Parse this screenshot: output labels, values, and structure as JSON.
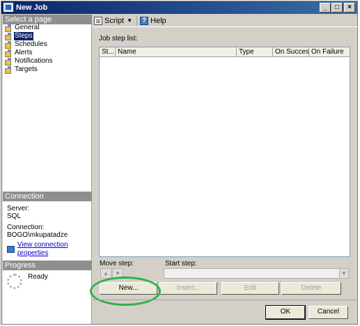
{
  "window": {
    "title": "New Job"
  },
  "left": {
    "select_page_header": "Select a page",
    "pages": [
      {
        "label": "General",
        "selected": false
      },
      {
        "label": "Steps",
        "selected": true
      },
      {
        "label": "Schedules",
        "selected": false
      },
      {
        "label": "Alerts",
        "selected": false
      },
      {
        "label": "Notifications",
        "selected": false
      },
      {
        "label": "Targets",
        "selected": false
      }
    ],
    "connection_header": "Connection",
    "server_label": "Server:",
    "server_value": "SQL",
    "connection_label": "Connection:",
    "connection_value": "BOGO\\mkupatadze",
    "view_connection_link": "View connection properties",
    "progress_header": "Progress",
    "progress_status": "Ready"
  },
  "toolbar": {
    "script_label": "Script",
    "help_label": "Help"
  },
  "steps": {
    "list_label": "Job step list:",
    "columns": [
      "St...",
      "Name",
      "Type",
      "On Success",
      "On Failure"
    ],
    "rows": [],
    "move_step_label": "Move step:",
    "start_step_label": "Start step:",
    "start_step_value": ""
  },
  "buttons": {
    "new": "New...",
    "insert": "Insert...",
    "edit": "Edit",
    "delete": "Delete",
    "ok": "OK",
    "cancel": "Cancel"
  },
  "colors": {
    "title_gradient_start": "#0a246a",
    "selected_item": "#0a246a",
    "highlight_ring": "#2bb24c",
    "link": "#0000cc"
  }
}
